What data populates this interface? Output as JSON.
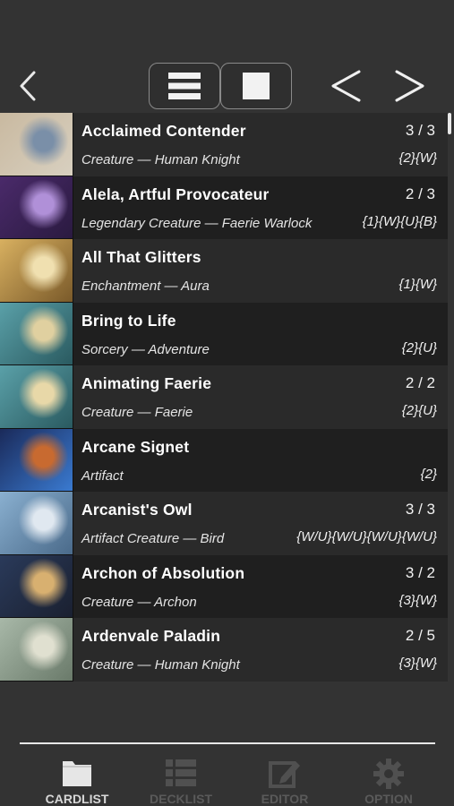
{
  "header": {
    "back_icon": "chevron-left-icon",
    "view_list_icon": "list-view-icon",
    "view_card_icon": "single-card-view-icon",
    "prev_icon": "chevron-left-icon",
    "next_icon": "chevron-right-icon"
  },
  "cards": [
    {
      "name": "Acclaimed Contender",
      "pt": "3 / 3",
      "type": "Creature — Human Knight",
      "cost": "{2}{W}",
      "art": [
        "#c9b9a0",
        "#7a8fa8",
        "#d8d0c0"
      ]
    },
    {
      "name": "Alela, Artful Provocateur",
      "pt": "2 / 3",
      "type": "Legendary Creature — Faerie Warlock",
      "cost": "{1}{W}{U}{B}",
      "art": [
        "#4a2a6a",
        "#b090d8",
        "#2a1a40"
      ]
    },
    {
      "name": "All That Glitters",
      "pt": "",
      "type": "Enchantment — Aura",
      "cost": "{1}{W}",
      "art": [
        "#d8b060",
        "#f0e0b0",
        "#7a5a2a"
      ]
    },
    {
      "name": "Bring to Life",
      "pt": "",
      "type": "Sorcery — Adventure",
      "cost": "{2}{U}",
      "art": [
        "#5aa0a8",
        "#e0d0a0",
        "#2a5a60"
      ]
    },
    {
      "name": "Animating Faerie",
      "pt": "2 / 2",
      "type": "Creature — Faerie",
      "cost": "{2}{U}",
      "art": [
        "#5aa0a8",
        "#e8d8a8",
        "#2a5a60"
      ]
    },
    {
      "name": "Arcane Signet",
      "pt": "",
      "type": "Artifact",
      "cost": "{2}",
      "art": [
        "#1a2a5a",
        "#c86a30",
        "#3a7ad0"
      ]
    },
    {
      "name": "Arcanist's Owl",
      "pt": "3 / 3",
      "type": "Artifact Creature — Bird",
      "cost": "{W/U}{W/U}{W/U}{W/U}",
      "art": [
        "#8ab0d0",
        "#e0e8f0",
        "#4a6a8a"
      ]
    },
    {
      "name": "Archon of Absolution",
      "pt": "3 / 2",
      "type": "Creature — Archon",
      "cost": "{3}{W}",
      "art": [
        "#2a3a5a",
        "#d8b070",
        "#1a2030"
      ]
    },
    {
      "name": "Ardenvale Paladin",
      "pt": "2 / 5",
      "type": "Creature — Human Knight",
      "cost": "{3}{W}",
      "art": [
        "#a8b8a8",
        "#e0e0d0",
        "#6a7a6a"
      ]
    }
  ],
  "tabs": [
    {
      "label": "CARDLIST",
      "icon": "folder-icon",
      "active": true
    },
    {
      "label": "DECKLIST",
      "icon": "list-icon",
      "active": false
    },
    {
      "label": "EDITOR",
      "icon": "edit-icon",
      "active": false
    },
    {
      "label": "OPTION",
      "icon": "gear-icon",
      "active": false
    }
  ]
}
